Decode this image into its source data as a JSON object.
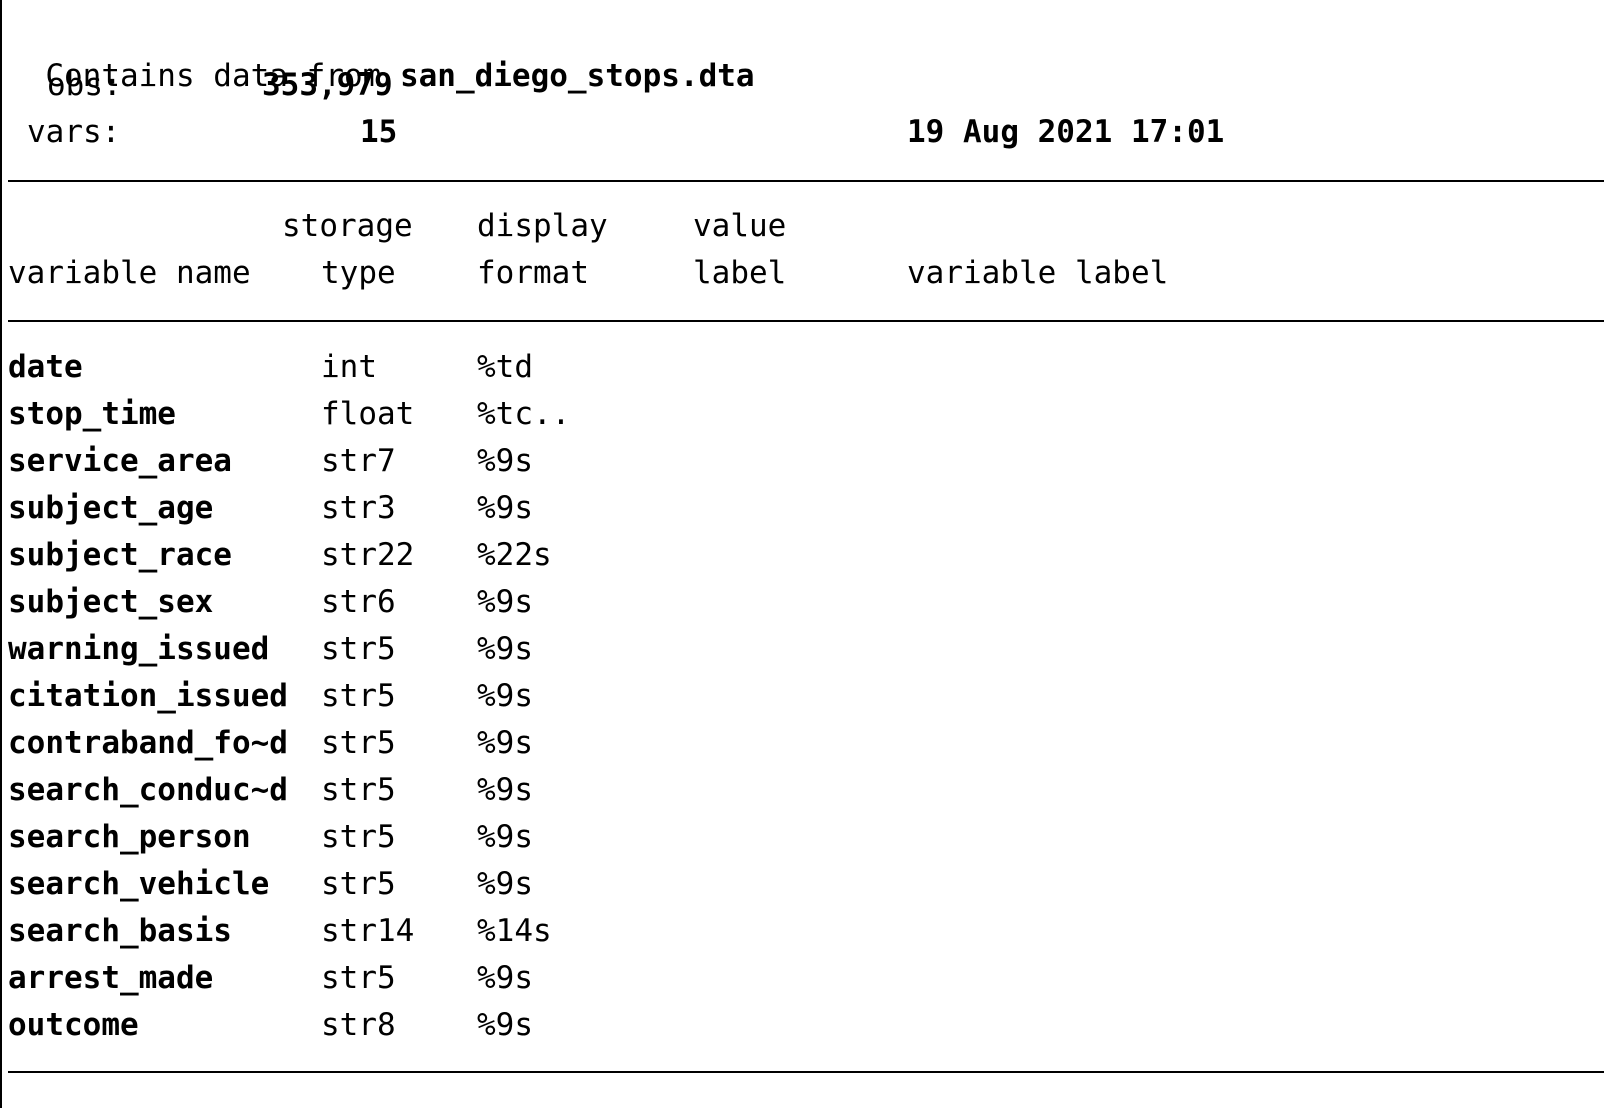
{
  "header": {
    "contains_prefix": "Contains data from",
    "filename": "san_diego_stops.dta",
    "obs_label": "obs:",
    "obs_value": "353,979",
    "vars_label": "vars:",
    "vars_value": "15",
    "timestamp": "19 Aug 2021 17:01"
  },
  "columns": {
    "storage_top": "storage",
    "display_top": "display",
    "value_top": "value",
    "variable_name": "variable name",
    "type": "type",
    "format": "format",
    "label": "label",
    "variable_label": "variable label"
  },
  "variables": [
    {
      "name": "date",
      "type": "int",
      "format": "%td"
    },
    {
      "name": "stop_time",
      "type": "float",
      "format": "%tc.."
    },
    {
      "name": "service_area",
      "type": "str7",
      "format": "%9s"
    },
    {
      "name": "subject_age",
      "type": "str3",
      "format": "%9s"
    },
    {
      "name": "subject_race",
      "type": "str22",
      "format": "%22s"
    },
    {
      "name": "subject_sex",
      "type": "str6",
      "format": "%9s"
    },
    {
      "name": "warning_issued",
      "type": "str5",
      "format": "%9s"
    },
    {
      "name": "citation_issued",
      "type": "str5",
      "format": "%9s"
    },
    {
      "name": "contraband_fo~d",
      "type": "str5",
      "format": "%9s"
    },
    {
      "name": "search_conduc~d",
      "type": "str5",
      "format": "%9s"
    },
    {
      "name": "search_person",
      "type": "str5",
      "format": "%9s"
    },
    {
      "name": "search_vehicle",
      "type": "str5",
      "format": "%9s"
    },
    {
      "name": "search_basis",
      "type": "str14",
      "format": "%14s"
    },
    {
      "name": "arrest_made",
      "type": "str5",
      "format": "%9s"
    },
    {
      "name": "outcome",
      "type": "str8",
      "format": "%9s"
    }
  ]
}
